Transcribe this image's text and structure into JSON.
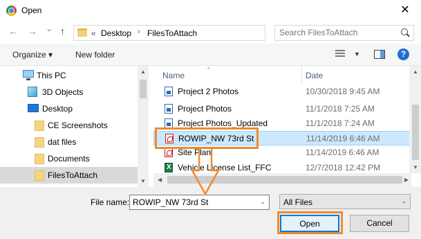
{
  "window": {
    "title": "Open",
    "close": "✕"
  },
  "nav": {
    "back": "←",
    "forward": "→",
    "recent": "⌄",
    "up": "↑",
    "address": {
      "overflow": "«",
      "crumbs": [
        "Desktop",
        "FilesToAttach"
      ]
    },
    "search": {
      "placeholder": "Search FilesToAttach"
    }
  },
  "toolbar": {
    "organize": "Organize ▾",
    "new_folder": "New folder"
  },
  "sidebar": {
    "items": [
      {
        "label": "This PC"
      },
      {
        "label": "3D Objects"
      },
      {
        "label": "Desktop"
      },
      {
        "label": "CE Screenshots"
      },
      {
        "label": "dat files"
      },
      {
        "label": "Documents"
      },
      {
        "label": "FilesToAttach"
      }
    ]
  },
  "filelist": {
    "columns": [
      "Name",
      "Date"
    ],
    "rows": [
      {
        "name": "Project 2 Photos",
        "date": "10/30/2018 9:45 AM",
        "type": "image"
      },
      {
        "name": "Project Photos",
        "date": "11/1/2018 7:25 AM",
        "type": "image"
      },
      {
        "name": "Project Photos_Updated",
        "date": "11/1/2018 7:24 AM",
        "type": "image"
      },
      {
        "name": "ROWIP_NW 73rd St",
        "date": "11/14/2019 6:46 AM",
        "type": "pdf"
      },
      {
        "name": "Site Plan",
        "date": "11/14/2019 6:46 AM",
        "type": "pdf"
      },
      {
        "name": "Vehicle License List_FFC",
        "date": "12/7/2018 12:42 PM",
        "type": "excel"
      }
    ]
  },
  "footer": {
    "file_name_label": "File name:",
    "file_name_value": "ROWIP_NW 73rd St",
    "filter": "All Files",
    "open": "Open",
    "cancel": "Cancel"
  },
  "accent": {
    "highlight": "#ef8a2e",
    "selection": "#cce8ff",
    "focus": "#0078d7"
  }
}
